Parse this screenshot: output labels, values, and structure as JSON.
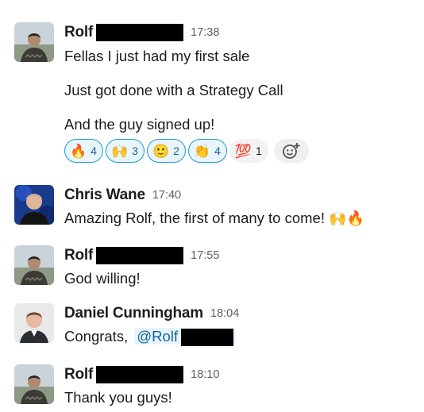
{
  "messages": [
    {
      "author": "Rolf",
      "time": "17:38",
      "lines": [
        "Fellas I just had my first sale",
        "Just got done with a Strategy Call",
        "And the guy signed up!"
      ],
      "reactions": [
        {
          "emoji": "🔥",
          "icon": "fire-icon",
          "count": "4",
          "reacted": true
        },
        {
          "emoji": "🙌",
          "icon": "raised-hands-icon",
          "count": "3",
          "reacted": true
        },
        {
          "emoji": "🙂",
          "icon": "slightly-smiling-face-icon",
          "count": "2",
          "reacted": true
        },
        {
          "emoji": "👏",
          "icon": "clapping-hands-icon",
          "count": "4",
          "reacted": true
        },
        {
          "emoji": "💯",
          "icon": "hundred-points-icon",
          "count": "1",
          "reacted": false
        }
      ]
    },
    {
      "author": "Chris Wane",
      "time": "17:40",
      "text": "Amazing Rolf, the first of many to come!",
      "trailing_emojis": [
        "🙌",
        "🔥"
      ]
    },
    {
      "author": "Rolf",
      "time": "17:55",
      "text": "God willing!"
    },
    {
      "author": "Daniel Cunningham",
      "time": "18:04",
      "text": "Congrats,",
      "mention": "@Rolf"
    },
    {
      "author": "Rolf",
      "time": "18:10",
      "text": "Thank you guys!"
    }
  ],
  "colors": {
    "link": "#1264a3",
    "reaction_border": "#1d9bd1",
    "reaction_bg": "#e8f5fa",
    "timestamp": "#616061"
  }
}
